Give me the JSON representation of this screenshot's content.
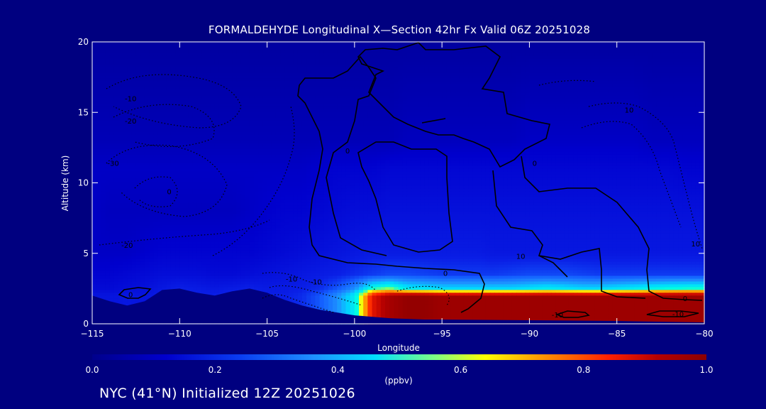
{
  "title": "FORMALDEHYDE Longitudinal X—Section 42hr  Fx Valid 06Z 20251028",
  "footer": "NYC (41°N) Initialized 12Z 20251026",
  "colors": {
    "background": "#000080",
    "text": "#ffffff",
    "colormap": [
      "#00008b",
      "#0000cd",
      "#0a1fe6",
      "#1460ff",
      "#1e90ff",
      "#00d8ff",
      "#00ffe0",
      "#ffff00",
      "#ff8c00",
      "#ff2000",
      "#b40000",
      "#8b0000"
    ]
  },
  "chart_data": {
    "type": "heatmap",
    "title": "FORMALDEHYDE Longitudinal X—Section 42hr  Fx Valid 06Z 20251028",
    "xlabel": "Longitude",
    "ylabel": "Altitude (km)",
    "xlim": [
      -115,
      -80
    ],
    "ylim": [
      0,
      20
    ],
    "xticks": [
      -115,
      -110,
      -105,
      -100,
      -95,
      -90,
      -85,
      -80
    ],
    "yticks": [
      0,
      5,
      10,
      15,
      20
    ],
    "colorbar": {
      "label": "(ppbv)",
      "range": [
        0.0,
        1.0
      ],
      "ticks": [
        "0.0",
        "0.2",
        "0.4",
        "0.6",
        "0.8",
        "1.0"
      ],
      "position": "bottom"
    },
    "terrain_km": [
      [
        -115,
        2.0
      ],
      [
        -114,
        1.6
      ],
      [
        -113,
        1.3
      ],
      [
        -112,
        1.6
      ],
      [
        -111,
        2.4
      ],
      [
        -110,
        2.5
      ],
      [
        -109,
        2.2
      ],
      [
        -108,
        2.0
      ],
      [
        -107,
        2.3
      ],
      [
        -106,
        2.5
      ],
      [
        -105,
        2.2
      ],
      [
        -104,
        1.7
      ],
      [
        -103,
        1.3
      ],
      [
        -102,
        1.0
      ],
      [
        -101,
        0.8
      ],
      [
        -100,
        0.6
      ],
      [
        -99,
        0.5
      ],
      [
        -98,
        0.4
      ],
      [
        -97,
        0.35
      ],
      [
        -96,
        0.3
      ],
      [
        -95,
        0.3
      ],
      [
        -90,
        0.25
      ],
      [
        -85,
        0.2
      ],
      [
        -80,
        0.1
      ]
    ],
    "levels": [
      {
        "alt_km": 2.0,
        "values": [
          0.15,
          0.15,
          0.16,
          0.15,
          0.18,
          0.2,
          0.19,
          0.18,
          0.2,
          0.2,
          0.18,
          0.18,
          0.2,
          0.26,
          0.36,
          0.5,
          0.85,
          0.94,
          0.98,
          0.98,
          0.96,
          0.96,
          0.96,
          0.96,
          0.96,
          0.96,
          0.96,
          0.96,
          0.96,
          0.96,
          0.96,
          0.96,
          0.96,
          0.96,
          0.96,
          0.96
        ]
      },
      {
        "alt_km": 2.5,
        "values": [
          0.12,
          0.12,
          0.13,
          0.14,
          0.16,
          0.18,
          0.17,
          0.16,
          0.17,
          0.18,
          0.17,
          0.17,
          0.18,
          0.2,
          0.26,
          0.36,
          0.55,
          0.6,
          0.5,
          0.48,
          0.46,
          0.46,
          0.46,
          0.46,
          0.46,
          0.48,
          0.5,
          0.48,
          0.46,
          0.46,
          0.48,
          0.5,
          0.52,
          0.54,
          0.55,
          0.55
        ]
      },
      {
        "alt_km": 3.5,
        "values": [
          0.1,
          0.1,
          0.11,
          0.12,
          0.13,
          0.13,
          0.13,
          0.12,
          0.12,
          0.13,
          0.14,
          0.15,
          0.16,
          0.17,
          0.18,
          0.2,
          0.22,
          0.24,
          0.24,
          0.23,
          0.22,
          0.22,
          0.22,
          0.22,
          0.23,
          0.24,
          0.24,
          0.24,
          0.23,
          0.22,
          0.22,
          0.22,
          0.22,
          0.22,
          0.22,
          0.22
        ]
      },
      {
        "alt_km": 5.0,
        "values": [
          0.08,
          0.08,
          0.08,
          0.09,
          0.1,
          0.1,
          0.1,
          0.1,
          0.1,
          0.1,
          0.11,
          0.12,
          0.13,
          0.14,
          0.15,
          0.16,
          0.17,
          0.17,
          0.17,
          0.17,
          0.17,
          0.17,
          0.17,
          0.16,
          0.16,
          0.16,
          0.16,
          0.16,
          0.16,
          0.16,
          0.16,
          0.16,
          0.16,
          0.16,
          0.16,
          0.16
        ]
      },
      {
        "alt_km": 8.0,
        "values": [
          0.08,
          0.07,
          0.07,
          0.07,
          0.07,
          0.07,
          0.07,
          0.07,
          0.07,
          0.08,
          0.09,
          0.1,
          0.1,
          0.11,
          0.12,
          0.13,
          0.13,
          0.14,
          0.14,
          0.14,
          0.14,
          0.14,
          0.14,
          0.14,
          0.14,
          0.14,
          0.14,
          0.14,
          0.14,
          0.14,
          0.14,
          0.14,
          0.14,
          0.14,
          0.14,
          0.14
        ]
      },
      {
        "alt_km": 11.0,
        "values": [
          0.08,
          0.08,
          0.08,
          0.08,
          0.08,
          0.08,
          0.08,
          0.08,
          0.08,
          0.08,
          0.08,
          0.08,
          0.08,
          0.09,
          0.1,
          0.1,
          0.1,
          0.11,
          0.11,
          0.11,
          0.11,
          0.11,
          0.11,
          0.11,
          0.11,
          0.11,
          0.11,
          0.11,
          0.11,
          0.11,
          0.11,
          0.11,
          0.11,
          0.11,
          0.1,
          0.1
        ]
      },
      {
        "alt_km": 13.0,
        "values": [
          0.06,
          0.06,
          0.06,
          0.06,
          0.06,
          0.06,
          0.06,
          0.06,
          0.06,
          0.06,
          0.06,
          0.06,
          0.06,
          0.06,
          0.06,
          0.06,
          0.06,
          0.06,
          0.07,
          0.07,
          0.07,
          0.07,
          0.07,
          0.07,
          0.07,
          0.08,
          0.08,
          0.08,
          0.08,
          0.08,
          0.08,
          0.08,
          0.07,
          0.07,
          0.07,
          0.07
        ]
      },
      {
        "alt_km": 20.0,
        "values": [
          0.03,
          0.03,
          0.03,
          0.03,
          0.03,
          0.03,
          0.03,
          0.03,
          0.03,
          0.03,
          0.03,
          0.03,
          0.03,
          0.03,
          0.03,
          0.03,
          0.03,
          0.03,
          0.03,
          0.03,
          0.03,
          0.03,
          0.03,
          0.03,
          0.03,
          0.03,
          0.03,
          0.03,
          0.03,
          0.03,
          0.03,
          0.03,
          0.03,
          0.03,
          0.03,
          0.03
        ]
      }
    ],
    "contour_labels": [
      {
        "text": "-10",
        "lon": -112.8,
        "alt": 15.8
      },
      {
        "text": "-20",
        "lon": -112.8,
        "alt": 14.2
      },
      {
        "text": "-30",
        "lon": -113.8,
        "alt": 11.2
      },
      {
        "text": "0",
        "lon": -110.6,
        "alt": 9.2
      },
      {
        "text": "-20",
        "lon": -113.0,
        "alt": 5.4
      },
      {
        "text": "-10",
        "lon": -103.6,
        "alt": 3.0
      },
      {
        "text": "-10",
        "lon": -102.2,
        "alt": 2.8
      },
      {
        "text": "0",
        "lon": -112.8,
        "alt": 1.9
      },
      {
        "text": "0",
        "lon": -100.4,
        "alt": 12.1
      },
      {
        "text": "0",
        "lon": -89.7,
        "alt": 11.2
      },
      {
        "text": "10",
        "lon": -84.3,
        "alt": 15.0
      },
      {
        "text": "0",
        "lon": -94.8,
        "alt": 3.4
      },
      {
        "text": "10",
        "lon": -90.5,
        "alt": 4.6
      },
      {
        "text": "0",
        "lon": -81.1,
        "alt": 1.6
      },
      {
        "text": "10",
        "lon": -80.5,
        "alt": 5.5
      },
      {
        "text": "-10",
        "lon": -88.4,
        "alt": 0.45
      },
      {
        "text": "-10",
        "lon": -81.5,
        "alt": 0.5
      }
    ]
  }
}
